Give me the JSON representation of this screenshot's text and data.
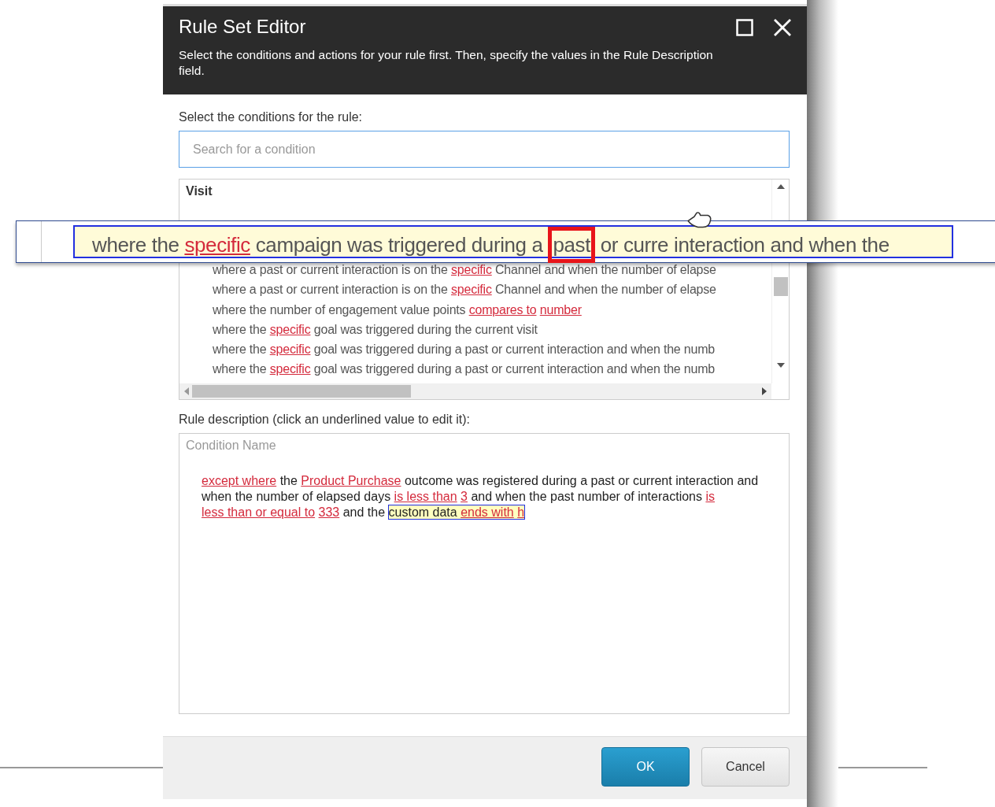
{
  "window": {
    "title": "Rule Set Editor",
    "subtitle": "Select the conditions and actions for your rule first. Then, specify the values in the Rule Description field."
  },
  "conditions": {
    "label": "Select the conditions for the rule:",
    "search": {
      "placeholder": "Search for a condition"
    },
    "group": "Visit",
    "items": [
      {
        "segments": [
          {
            "kind": "text",
            "text": "where a past or current interaction is on the"
          },
          {
            "kind": "link",
            "text": "specific"
          },
          {
            "kind": "text",
            "text": "Channel and when the number of elapse"
          }
        ]
      },
      {
        "segments": [
          {
            "kind": "text",
            "text": "where a past or current interaction is on the"
          },
          {
            "kind": "link",
            "text": "specific"
          },
          {
            "kind": "text",
            "text": "Channel and when the number of elapse"
          }
        ]
      },
      {
        "segments": [
          {
            "kind": "text",
            "text": "where the number of engagement value points"
          },
          {
            "kind": "link",
            "text": "compares to"
          },
          {
            "kind": "link",
            "text": "number"
          }
        ]
      },
      {
        "segments": [
          {
            "kind": "text",
            "text": "where the"
          },
          {
            "kind": "link",
            "text": "specific"
          },
          {
            "kind": "text",
            "text": "goal was triggered during the current visit"
          }
        ]
      },
      {
        "segments": [
          {
            "kind": "text",
            "text": "where the"
          },
          {
            "kind": "link",
            "text": "specific"
          },
          {
            "kind": "text",
            "text": "goal was triggered during a past or current interaction and when the numb"
          }
        ]
      },
      {
        "segments": [
          {
            "kind": "text",
            "text": "where the"
          },
          {
            "kind": "link",
            "text": "specific"
          },
          {
            "kind": "text",
            "text": "goal was triggered during a past or current interaction and when the numb"
          }
        ]
      }
    ]
  },
  "callout": {
    "segments": [
      {
        "kind": "text",
        "text": "where the"
      },
      {
        "kind": "link",
        "text": "specific"
      },
      {
        "kind": "text",
        "text": "campaign was triggered during a"
      },
      {
        "kind": "boxed",
        "text": "past"
      },
      {
        "kind": "text",
        "text": "or curre"
      },
      {
        "kind": "text",
        "text": "interaction and when the"
      }
    ]
  },
  "description": {
    "label": "Rule description (click an underlined value to edit it):",
    "condition_name": "Condition Name",
    "parts": [
      {
        "highlighted": false,
        "segments": [
          {
            "kind": "link",
            "text": "except where"
          },
          {
            "kind": "text",
            "text": "the"
          },
          {
            "kind": "link",
            "text": "Product Purchase"
          },
          {
            "kind": "text",
            "text": "outcome was registered during a past or current interaction and when the number of elapsed days"
          },
          {
            "kind": "link",
            "text": "is less than"
          },
          {
            "kind": "link",
            "text": "3"
          },
          {
            "kind": "text",
            "text": "and when the past number of interactions"
          },
          {
            "kind": "link",
            "text": "is"
          },
          {
            "kind": "link",
            "text": "less than or equal to"
          },
          {
            "kind": "link",
            "text": "333"
          },
          {
            "kind": "text",
            "text": "and the"
          }
        ]
      },
      {
        "highlighted": true,
        "segments": [
          {
            "kind": "text",
            "text": "custom data"
          },
          {
            "kind": "link",
            "text": "ends with"
          },
          {
            "kind": "link",
            "text": "h"
          }
        ]
      }
    ]
  },
  "buttons": [
    {
      "label": "OK",
      "kind": "primary"
    },
    {
      "label": "Cancel",
      "kind": "secondary"
    }
  ]
}
